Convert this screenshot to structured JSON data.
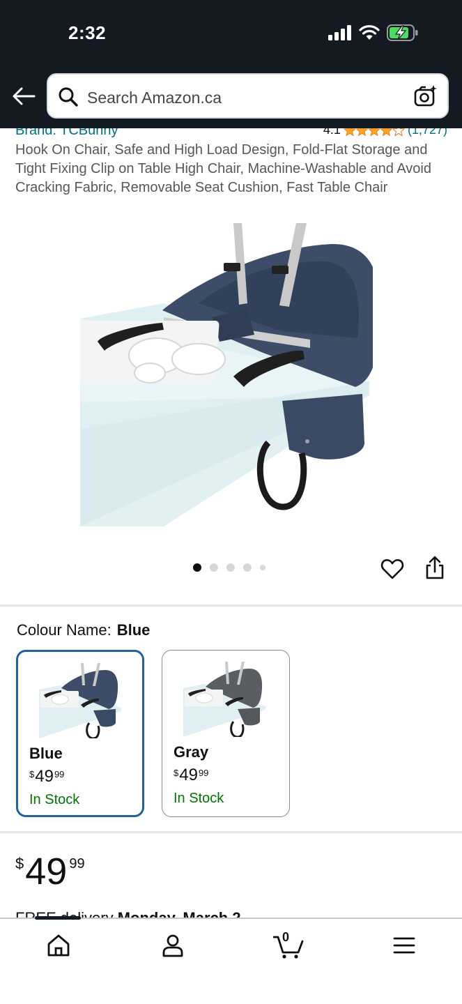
{
  "status_bar": {
    "time": "2:32"
  },
  "search": {
    "placeholder": "Search Amazon.ca"
  },
  "product": {
    "brand": "Brand: TCBunny",
    "rating": "4.1",
    "rating_stars": 4.1,
    "rating_count": "(1,727)",
    "title": "Hook On Chair, Safe and High Load Design, Fold-Flat Storage and Tight Fixing Clip on Table High Chair, Machine-Washable and Avoid Cracking Fabric, Removable Seat Cushion, Fast Table Chair",
    "image_count": 5,
    "active_image": 1
  },
  "colour": {
    "label": "Colour Name:",
    "selected": "Blue",
    "options": [
      {
        "name": "Blue",
        "currency": "$",
        "whole": "49",
        "fraction": "99",
        "stock": "In Stock"
      },
      {
        "name": "Gray",
        "currency": "$",
        "whole": "49",
        "fraction": "99",
        "stock": "In Stock"
      }
    ]
  },
  "price": {
    "currency": "$",
    "whole": "49",
    "fraction": "99"
  },
  "delivery": {
    "prefix": "FREE delivery",
    "date": "Monday, March 2"
  },
  "cart": {
    "count": "0"
  },
  "colors": {
    "header_bg": "#131a22",
    "link": "#007185",
    "in_stock": "#007600",
    "selected_border": "#2162a1",
    "star": "#ffa41c"
  },
  "icons": {
    "back": "back-arrow-icon",
    "search": "search-icon",
    "camera": "camera-search-icon",
    "heart": "heart-icon",
    "share": "share-icon",
    "home": "home-icon",
    "account": "account-icon",
    "cart": "cart-icon",
    "menu": "menu-icon"
  }
}
